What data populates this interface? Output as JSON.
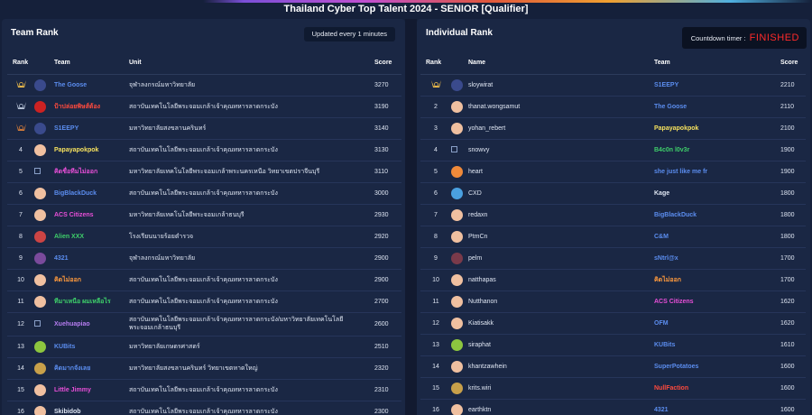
{
  "page_title": "Thailand Cyber Top Talent 2024 - SENIOR [Qualifier]",
  "team_rank": {
    "title": "Team Rank",
    "updated_label": "Updated every 1 minutes",
    "headers": {
      "rank": "Rank",
      "team": "Team",
      "unit": "Unit",
      "score": "Score"
    },
    "rows": [
      {
        "rank": "",
        "medal": "gold-medal-icon",
        "logo": "#3a4a8c",
        "team": "The Goose",
        "color": "#5b8def",
        "unit": "จุฬาลงกรณ์มหาวิทยาลัย",
        "score": "3270"
      },
      {
        "rank": "",
        "medal": "silver-medal-icon",
        "logo": "#c22",
        "team": "ป้าปล่อยพิษส์ต้อง",
        "color": "#ff4a3d",
        "unit": "สถาบันเทคโนโลยีพระจอมเกล้าเจ้าคุณทหารลาดกระบัง",
        "score": "3190"
      },
      {
        "rank": "",
        "medal": "bronze-medal-icon",
        "logo": "#3a4a8c",
        "team": "S1EEPY",
        "color": "#5b8def",
        "unit": "มหาวิทยาลัยสงขลานครินทร์",
        "score": "3140"
      },
      {
        "rank": "4",
        "logo": "#f0c0a0",
        "team": "Papayapokpok",
        "color": "#f7e25e",
        "unit": "สถาบันเทคโนโลยีพระจอมเกล้าเจ้าคุณทหารลาดกระบัง",
        "score": "3130"
      },
      {
        "rank": "5",
        "logo": "",
        "team": "คิดชื่อทีมไม่ออก",
        "color": "#e84fd8",
        "unit": "มหาวิทยาลัยเทคโนโลยีพระจอมเกล้าพระนครเหนือ วิทยาเขตปราจีนบุรี",
        "score": "3110"
      },
      {
        "rank": "6",
        "logo": "#f0c0a0",
        "team": "BigBlackDuck",
        "color": "#5b8def",
        "unit": "สถาบันเทคโนโลยีพระจอมเกล้าเจ้าคุณทหารลาดกระบัง",
        "score": "3000"
      },
      {
        "rank": "7",
        "logo": "#f0c0a0",
        "team": "ACS Citizens",
        "color": "#e84fd8",
        "unit": "มหาวิทยาลัยเทคโนโลยีพระจอมเกล้าธนบุรี",
        "score": "2930"
      },
      {
        "rank": "8",
        "logo": "#c44",
        "team": "Alien XXX",
        "color": "#3ecf6a",
        "unit": "โรงเรียนนายร้อยตำรวจ",
        "score": "2920"
      },
      {
        "rank": "9",
        "logo": "#7a4a9c",
        "team": "4321",
        "color": "#5b8def",
        "unit": "จุฬาลงกรณ์มหาวิทยาลัย",
        "score": "2900"
      },
      {
        "rank": "10",
        "logo": "#f0c0a0",
        "team": "คิดไม่ออก",
        "color": "#ff9a3d",
        "unit": "สถาบันเทคโนโลยีพระจอมเกล้าเจ้าคุณทหารลาดกระบัง",
        "score": "2900"
      },
      {
        "rank": "11",
        "logo": "#f0c0a0",
        "team": "ทีมาเหนือ ผมเหลือไร",
        "color": "#3ecf6a",
        "unit": "สถาบันเทคโนโลยีพระจอมเกล้าเจ้าคุณทหารลาดกระบัง",
        "score": "2700"
      },
      {
        "rank": "12",
        "logo": "",
        "team": "Xuehuapiao",
        "color": "#b57cf0",
        "unit": "สถาบันเทคโนโลยีพระจอมเกล้าเจ้าคุณทหารลาดกระบัง/มหาวิทยาลัยเทคโนโลยีพระจอมเกล้าธนบุรี",
        "score": "2600",
        "tall": true
      },
      {
        "rank": "13",
        "logo": "#8dc63f",
        "team": "KUBits",
        "color": "#5b8def",
        "unit": "มหาวิทยาลัยเกษตรศาสตร์",
        "score": "2510"
      },
      {
        "rank": "14",
        "logo": "#c8a04a",
        "team": "คิดมากจังเลย",
        "color": "#5b8def",
        "unit": "มหาวิทยาลัยสงขลานครินทร์ วิทยาเขตหาดใหญ่",
        "score": "2320"
      },
      {
        "rank": "15",
        "logo": "#f0c0a0",
        "team": "Little Jimmy",
        "color": "#e84fd8",
        "unit": "สถาบันเทคโนโลยีพระจอมเกล้าเจ้าคุณทหารลาดกระบัง",
        "score": "2310"
      },
      {
        "rank": "16",
        "logo": "#f0c0a0",
        "team": "Skibidob",
        "color": "#dfe6f3",
        "unit": "สถาบันเทคโนโลยีพระจอมเกล้าเจ้าคุณทหารลาดกระบัง",
        "score": "2300"
      }
    ]
  },
  "individual_rank": {
    "title": "Individual Rank",
    "countdown_label": "Countdown timer :",
    "countdown_status": "FINISHED",
    "headers": {
      "rank": "Rank",
      "name": "Name",
      "team": "Team",
      "score": "Score"
    },
    "rows": [
      {
        "rank": "",
        "medal": "gold-medal-icon",
        "logo": "#3a4a8c",
        "name": "sloywirat",
        "team": "S1EEPY",
        "color": "#5b8def",
        "score": "2210"
      },
      {
        "rank": "2",
        "logo": "#f0c0a0",
        "name": "thanat.wongsamut",
        "team": "The Goose",
        "color": "#5b8def",
        "score": "2110"
      },
      {
        "rank": "3",
        "logo": "#f0c0a0",
        "name": "yohan_rebert",
        "team": "Papayapokpok",
        "color": "#f7e25e",
        "score": "2100"
      },
      {
        "rank": "4",
        "logo": "",
        "name": "snowvy",
        "team": "B4c0n l0v3r",
        "color": "#3ecf6a",
        "score": "1900"
      },
      {
        "rank": "5",
        "logo": "#f08a3a",
        "name": "heart",
        "team": "she just like me fr",
        "color": "#5b8def",
        "score": "1900"
      },
      {
        "rank": "6",
        "logo": "#4aa0e0",
        "name": "CXD",
        "team": "Kage",
        "color": "#dfe6f3",
        "score": "1800"
      },
      {
        "rank": "7",
        "logo": "#f0c0a0",
        "name": "redaxn",
        "team": "BigBlackDuck",
        "color": "#5b8def",
        "score": "1800"
      },
      {
        "rank": "8",
        "logo": "#f0c0a0",
        "name": "PtmCn",
        "team": "C&M",
        "color": "#5b8def",
        "score": "1800"
      },
      {
        "rank": "9",
        "logo": "#7a3a4a",
        "name": "pelm",
        "team": "sNtrl@x",
        "color": "#5b8def",
        "score": "1700"
      },
      {
        "rank": "10",
        "logo": "#f0c0a0",
        "name": "natthapas",
        "team": "คิดไม่ออก",
        "color": "#ff9a3d",
        "score": "1700"
      },
      {
        "rank": "11",
        "logo": "#f0c0a0",
        "name": "Nutthanon",
        "team": "ACS Citizens",
        "color": "#e84fd8",
        "score": "1620"
      },
      {
        "rank": "12",
        "logo": "#f0c0a0",
        "name": "Kiatisakk",
        "team": "OFM",
        "color": "#5b8def",
        "score": "1620"
      },
      {
        "rank": "13",
        "logo": "#8dc63f",
        "name": "siraphat",
        "team": "KUBits",
        "color": "#5b8def",
        "score": "1610"
      },
      {
        "rank": "14",
        "logo": "#f0c0a0",
        "name": "khantzawhein",
        "team": "SuperPotatoes",
        "color": "#5b8def",
        "score": "1600"
      },
      {
        "rank": "15",
        "logo": "#c8a04a",
        "name": "krits.wiri",
        "team": "NullFaction",
        "color": "#ff4a3d",
        "score": "1600"
      },
      {
        "rank": "16",
        "logo": "#f0c0a0",
        "name": "earthktn",
        "team": "4321",
        "color": "#5b8def",
        "score": "1600"
      }
    ]
  }
}
